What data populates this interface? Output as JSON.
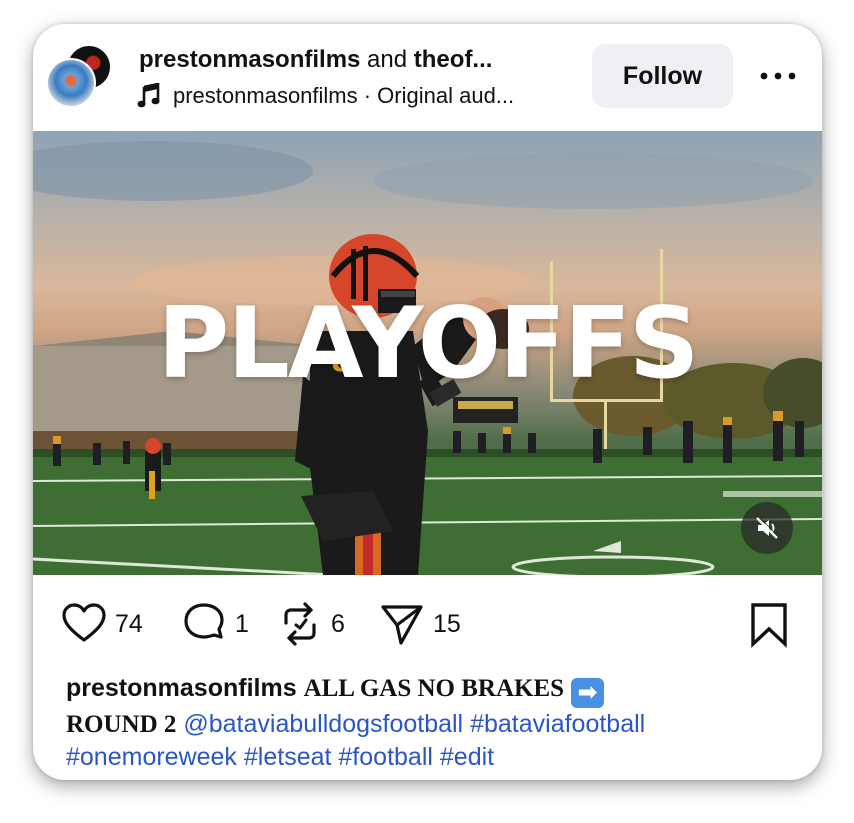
{
  "header": {
    "username_primary": "prestonmasonfilms",
    "joiner": " and ",
    "username_secondary": "theof...",
    "audio_text": "prestonmasonfilms · Original aud...",
    "follow_label": "Follow"
  },
  "media": {
    "overlay_text": "PLAYOFFS",
    "muted": true
  },
  "actions": {
    "likes": "74",
    "comments": "1",
    "reposts": "6",
    "shares": "15"
  },
  "caption": {
    "username": "prestonmasonfilms",
    "text_line1": "ALL GAS NO BRAKES",
    "emoji": "➡",
    "text_line2": "ROUND 2",
    "mention": "@bataviabulldogsfootball",
    "tag1": "#bataviafootball",
    "tag2": "#onemoreweek",
    "tag3": "#letseat",
    "tag4": "#football",
    "tag5": "#edit"
  },
  "colors": {
    "link": "#2b56c9",
    "follow_bg": "#efeff4",
    "helmet": "#d6462a",
    "jersey": "#1a1a1a"
  },
  "icons": [
    "music-icon",
    "more-icon",
    "mute-icon",
    "heart-icon",
    "comment-icon",
    "repost-icon",
    "share-icon",
    "bookmark-icon"
  ]
}
